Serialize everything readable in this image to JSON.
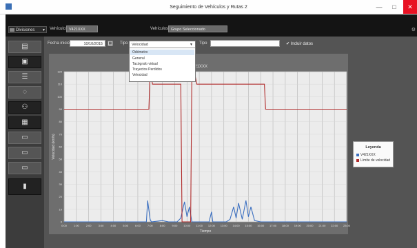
{
  "window": {
    "title": "Seguimiento de Vehículos y Rutas 2",
    "minimize": "—",
    "maximize": "□",
    "close": "✕"
  },
  "toolbar": {
    "group_select": "Divisiones",
    "vehicle_label": "Vehículo:",
    "vehicle_value": "V421XXX",
    "vehicles_label": "Vehículos:",
    "vehicles_value": "Grupo Seleccionado",
    "settings_icon": "gear-icon"
  },
  "sidebar": {
    "buttons": [
      "map-icon",
      "truck-icon",
      "list-icon",
      "route-icon",
      "person-icon",
      "report-icon",
      "chart-icon",
      "settings-icon",
      "history-icon",
      "door-icon"
    ]
  },
  "filters": {
    "start_label": "Fecha inicio",
    "start_value": "10/10/2015",
    "type_label": "Tipo",
    "type_value": "Velocidad",
    "type_options": [
      "Odómetro",
      "General",
      "Tacógrafo virtual",
      "Trayectos Perdidos",
      "Velocidad"
    ],
    "type_highlighted": 0,
    "type2_label": "Tipo",
    "type2_value": "",
    "checkbox_label": "Incluir datos"
  },
  "chart_data": {
    "type": "line",
    "title": "V421XXX",
    "xlabel": "Tiempo",
    "ylabel": "Velocidad (km/h)",
    "x_ticks": [
      "0:00",
      "1:00",
      "2:00",
      "3:00",
      "4:00",
      "5:00",
      "6:00",
      "7:00",
      "8:00",
      "9:00",
      "10:00",
      "11:00",
      "12:00",
      "13:00",
      "14:00",
      "15:00",
      "16:00",
      "17:00",
      "18:00",
      "19:00",
      "20:00",
      "21:00",
      "22:00",
      "23:00"
    ],
    "y_ticks": [
      "0",
      "10",
      "20",
      "30",
      "40",
      "50",
      "60",
      "70",
      "80",
      "90",
      "100",
      "110",
      "120"
    ],
    "ylim": [
      0,
      120
    ],
    "series": [
      {
        "name": "V421XXX",
        "color": "#3b6fc0",
        "values": [
          [
            0,
            0
          ],
          [
            6.7,
            0
          ],
          [
            6.8,
            17
          ],
          [
            7.0,
            2
          ],
          [
            7.1,
            0
          ],
          [
            8,
            1
          ],
          [
            8.5,
            0
          ],
          [
            9.2,
            0
          ],
          [
            9.5,
            3
          ],
          [
            9.8,
            16
          ],
          [
            10.0,
            4
          ],
          [
            10.2,
            12
          ],
          [
            10.4,
            0
          ],
          [
            11.8,
            0
          ],
          [
            12.0,
            8
          ],
          [
            12.1,
            0
          ],
          [
            13.2,
            0
          ],
          [
            13.5,
            2
          ],
          [
            13.8,
            12
          ],
          [
            14.0,
            3
          ],
          [
            14.2,
            15
          ],
          [
            14.5,
            2
          ],
          [
            14.8,
            17
          ],
          [
            15.0,
            4
          ],
          [
            15.2,
            12
          ],
          [
            15.5,
            1
          ],
          [
            16,
            0
          ],
          [
            16.3,
            0
          ],
          [
            16.6,
            0
          ],
          [
            23,
            0
          ]
        ]
      },
      {
        "name": "Límite de velocidad",
        "color": "#b02a2a",
        "values": [
          [
            0,
            90
          ],
          [
            6.9,
            90
          ],
          [
            7.0,
            120
          ],
          [
            7.2,
            110
          ],
          [
            9.5,
            110
          ],
          [
            9.6,
            0
          ],
          [
            10.3,
            0
          ],
          [
            10.4,
            120
          ],
          [
            10.6,
            120
          ],
          [
            10.8,
            110
          ],
          [
            16.3,
            110
          ],
          [
            16.4,
            90
          ],
          [
            23,
            90
          ]
        ]
      }
    ]
  },
  "legend": {
    "title": "Leyenda",
    "items": [
      "V421XXX",
      "Límite de velocidad"
    ]
  }
}
